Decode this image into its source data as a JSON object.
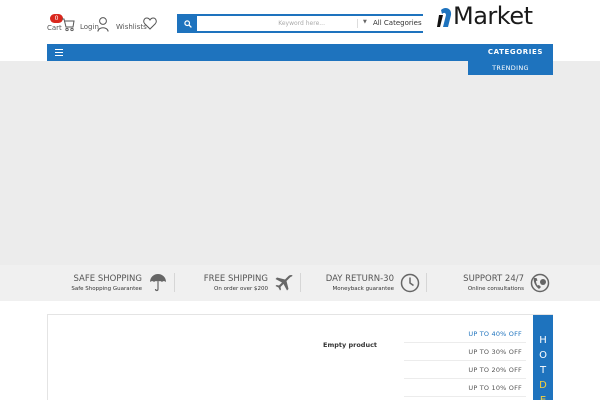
{
  "header": {
    "cart_count": "0",
    "cart_label": "Cart",
    "login_label": "Login",
    "wishlist_label": "Wishlists",
    "search_placeholder": "Keyword here...",
    "category_select": "All Categories",
    "logo_text": "Market",
    "brand_color": "#1e73be"
  },
  "nav": {
    "categories_label": "CATEGORIES",
    "trending_label": "TRENDING"
  },
  "features": [
    {
      "title": "SAFE SHOPPING",
      "subtitle": "Safe Shopping Guarantee",
      "icon": "umbrella-icon"
    },
    {
      "title": "FREE SHIPPING",
      "subtitle": "On order over $200",
      "icon": "airplane-icon"
    },
    {
      "title": "DAY RETURN-30",
      "subtitle": "Moneyback guarantee",
      "icon": "clock-icon"
    },
    {
      "title": "SUPPORT 24/7",
      "subtitle": "Online consultations",
      "icon": "phone-24h-icon"
    }
  ],
  "deals": {
    "empty_text": "Empty product",
    "offers": [
      "UP TO 40% OFF",
      "UP TO 30% OFF",
      "UP TO 20% OFF",
      "UP TO 10% OFF"
    ],
    "hot_label": [
      "H",
      "O",
      "T",
      "D",
      "E"
    ]
  }
}
